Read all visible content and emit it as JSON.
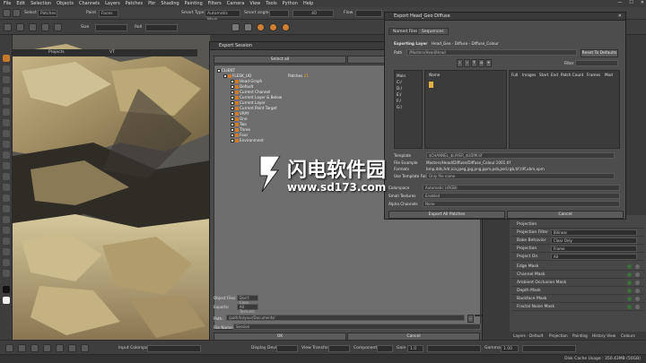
{
  "menubar": {
    "items": [
      "File",
      "Edit",
      "Selection",
      "Objects",
      "Channels",
      "Layers",
      "Patches",
      "Pbr",
      "Shading",
      "Painting",
      "Filters",
      "Camera",
      "View",
      "Tools",
      "Python",
      "Help"
    ],
    "window_controls": [
      "—",
      "☐",
      "✕"
    ]
  },
  "toolbar1": {
    "select_label": "Select",
    "select_value": "Patches",
    "paint_label": "Paint",
    "paint_value": "Faces",
    "smart_type_label": "Smart Type:",
    "smart_type_value": "Automatic Mask",
    "smart_angle_label": "Smart angle:",
    "smart_angle_value": "40",
    "flow_label": "Flow"
  },
  "toolbar2": {
    "size_label": "Size",
    "roll_label": "Roll"
  },
  "viewport": {
    "tabs": [
      "Projects",
      "VT"
    ]
  },
  "export_session": {
    "title": "Export Session",
    "select_all": "Select all",
    "select_none": "Select none",
    "tree_root": "CLIENT",
    "tree_child": "FLESK_UD",
    "patches_label": "Patches",
    "patches_count": "21",
    "items": [
      "Head Graph",
      "Default",
      "Current Channel",
      "Current Layer & Below",
      "Current Layer",
      "Current Paint Target",
      "VRAY"
    ],
    "folders": [
      "One",
      "Two",
      "Three",
      "Four",
      "Environment"
    ],
    "object_files_label": "Object Files:",
    "object_files_value": "Don't Copy",
    "exports_label": "Exports:",
    "exports_value": "All Textures",
    "path_label": "Path:",
    "path_value": "/path/to/your/Documents/",
    "file_name_label": "File Name:",
    "file_name_value": "Session",
    "ok": "OK",
    "cancel": "Cancel"
  },
  "export_head": {
    "title": "Export Head_Geo Diffuse",
    "tabs": [
      "Named Files",
      "Sequences"
    ],
    "exporting_layer_label": "Exporting Layer",
    "exporting_layer_value": "Head_Geo - Diffuse - Diffuse_Colour",
    "path_label": "Path",
    "path_value": "/Masters/Head/Head",
    "reset_defaults": "Reset To Defaults",
    "filter_label": "Filter",
    "drives": [
      "Main",
      "C:/",
      "D:/",
      "E:/",
      "F:/",
      "G:/"
    ],
    "name_header": "Name",
    "columns": [
      "Full",
      "Images",
      "Start",
      "End",
      "Patch Count",
      "Frames",
      "Mod"
    ],
    "template_label": "Template",
    "template_value": "$CHANNEL_$LAYER_$UDIM.tif",
    "file_example_label": "File Example",
    "file_example_value": "Masters/Head/Diffuse/Diffuse_Colour.1001.tif",
    "formats_label": "Formats",
    "formats_value": "bmp,dds,hdr,ico,jpeg,jpg,png,ppm,psb,psd,rgb,tif,tiff,xbm,xpm",
    "use_template_label": "Use Template For",
    "use_template_value": "Only file name",
    "colorspace_label": "Colorspace",
    "colorspace_value": "Automatic (sRGB)",
    "small_textures_label": "Small Textures",
    "small_textures_value": "Enabled",
    "alpha_channels_label": "Alpha Channels",
    "alpha_channels_value": "None",
    "export_all": "Export All Patches",
    "cancel": "Cancel"
  },
  "right_panel": {
    "rows": [
      "Projection",
      "Projection Filter",
      "Bake Behavior",
      "Projection",
      "Project On",
      "Edge Mask",
      "Channel Mask",
      "Ambient Occlusion Mask",
      "Depth Mask",
      "Backface Mask",
      "Fractal Noise Mask"
    ],
    "fields": [
      "Bilinear",
      "Clear Only",
      "Frame",
      "All"
    ],
    "tabs": [
      "Layers - Default",
      "Projection",
      "Painting",
      "History View",
      "Colours"
    ]
  },
  "bottombar": {
    "input_colorspace_label": "Input Colorspace",
    "display_device_label": "Display Device",
    "view_transform_label": "View Transform",
    "component_label": "Component",
    "gain_label": "Gain",
    "gain_value": "1.0",
    "gamma_label": "Gamma",
    "gamma_value": "1.00"
  },
  "statusbar": {
    "disk_cache": "Disk Cache Usage : 350.43MB (50GB)"
  },
  "watermark": {
    "cn_text": "闪电软件园",
    "url": "www.sd173.com"
  },
  "colors": {
    "accent": "#e08a2a",
    "dialog_bg": "#4a4a4a",
    "tree_bg": "#6e6e6e"
  }
}
